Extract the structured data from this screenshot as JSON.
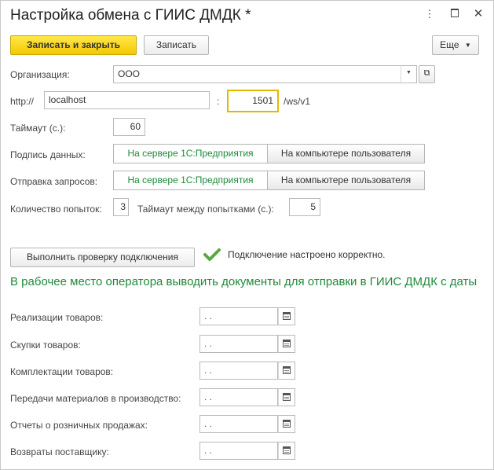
{
  "window": {
    "title": "Настройка обмена с ГИИС ДМДК *"
  },
  "toolbar": {
    "save_close_label": "Записать и закрыть",
    "save_label": "Записать",
    "more_label": "Еще"
  },
  "organization": {
    "label": "Организация:",
    "value": "ООО"
  },
  "connection": {
    "protocol_label": "http://",
    "host": "localhost",
    "separator": ":",
    "port": "1501",
    "path": "/ws/v1"
  },
  "timeout": {
    "label": "Таймаут (с.):",
    "value": "60"
  },
  "signature": {
    "label": "Подпись данных:",
    "options": [
      "На сервере 1С:Предприятия",
      "На компьютере пользователя"
    ],
    "selected": 0
  },
  "requests": {
    "label": "Отправка запросов:",
    "options": [
      "На сервере 1С:Предприятия",
      "На компьютере пользователя"
    ],
    "selected": 0
  },
  "attempts": {
    "label": "Количество попыток:",
    "value": "3",
    "interval_label": "Таймаут между попытками (с.):",
    "interval_value": "5"
  },
  "check": {
    "button_label": "Выполнить проверку подключения",
    "status_text": "Подключение настроено корректно."
  },
  "documents": {
    "header": "В рабочее место оператора выводить документы для отправки в ГИИС ДМДК с даты",
    "rows": [
      {
        "label": "Реализации товаров:",
        "value": " .  ."
      },
      {
        "label": "Скупки товаров:",
        "value": " .  ."
      },
      {
        "label": "Комплектации товаров:",
        "value": " .  ."
      },
      {
        "label": "Передачи материалов в производство:",
        "value": " .  ."
      },
      {
        "label": "Отчеты о розничных продажах:",
        "value": " .  ."
      },
      {
        "label": "Возвраты поставщику:",
        "value": " .  ."
      }
    ]
  },
  "colors": {
    "accent": "#1e8a3a",
    "primary_button": "#f5c800",
    "check_icon": "#5aa843"
  }
}
